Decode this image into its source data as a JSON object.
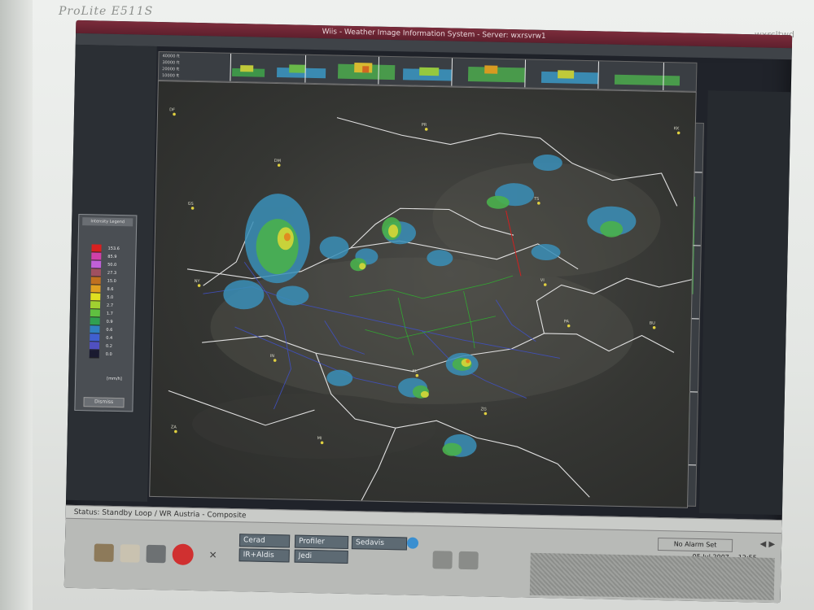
{
  "monitor": {
    "brand": "ProLite E511S",
    "label_right": "wxrcltwd"
  },
  "window": {
    "title": "Wiis - Weather Image Information System - Server: wxrsvrw1"
  },
  "profile": {
    "altitudes": [
      "40000 ft",
      "30000 ft",
      "20000 ft",
      "10000 ft"
    ]
  },
  "legend": {
    "title": "Intensity Legend",
    "values": [
      "153.6",
      "85.9",
      "50.0",
      "27.3",
      "15.0",
      "8.6",
      "5.0",
      "2.7",
      "1.7",
      "0.9",
      "0.6",
      "0.4",
      "0.2",
      "0.0"
    ],
    "colors": [
      "#d8201f",
      "#d040a8",
      "#c060d8",
      "#a05060",
      "#c07020",
      "#e0a020",
      "#e0e020",
      "#a0d030",
      "#60c040",
      "#30a050",
      "#3080c0",
      "#4060d0",
      "#5050c0",
      "#1a1a30"
    ],
    "unit": "[mm/h]",
    "dismiss": "Dismiss"
  },
  "status": {
    "text": "Status: Standby Loop / WR Austria - Composite"
  },
  "taskbar": {
    "buttons": [
      "Cerad",
      "Profiler",
      "Sedavis",
      "IR+Aldis",
      "Jedi"
    ],
    "alarm": "No Alarm Set",
    "datetime": "05 Jul 2007 -- 12:55"
  },
  "map": {
    "cities": [
      "DF",
      "PR",
      "KK",
      "DM",
      "GS",
      "TS",
      "NY",
      "PA",
      "BU",
      "VI",
      "IN",
      "KL",
      "ZG",
      "ZA",
      "MI"
    ]
  },
  "colors": {
    "titlebar": "#7b2c3b",
    "border_lines": "#e0e0e0",
    "rivers": "#4050c0",
    "region_lines": "#30b030"
  }
}
